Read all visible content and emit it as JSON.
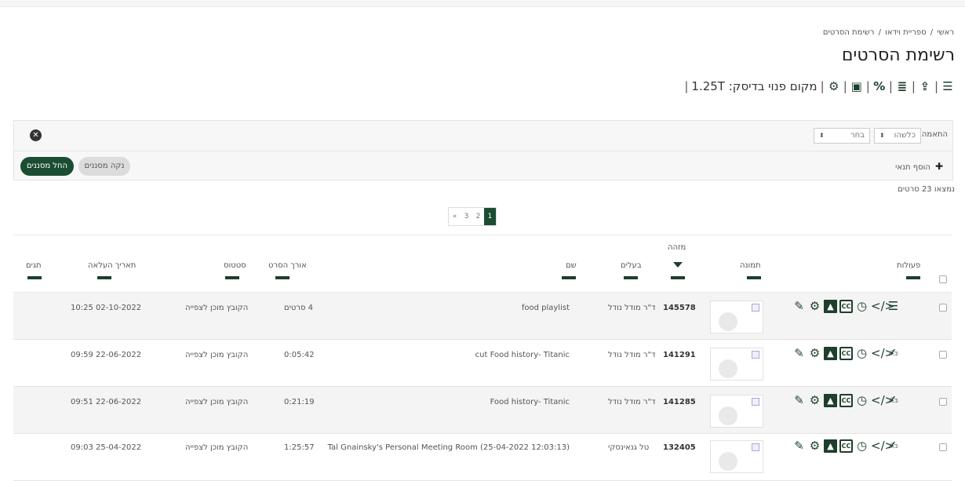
{
  "breadcrumb": [
    "ראשי",
    "ספריית וידאו",
    "רשימת הסרטים"
  ],
  "breadcrumb_sep": "/",
  "page_title": "רשימת הסרטים",
  "toolbar": {
    "disk_label": "מקום פנוי בדיסק:",
    "disk_value": "1.25T"
  },
  "filter": {
    "match_label": "התאמה",
    "select_any": "כלשהו",
    "select_choose": "בחר",
    "add_condition": "הוסף תנאי",
    "clear_button": "נקה מסננים",
    "apply_button": "החל מסננים"
  },
  "found_text": "נמצאו 23 סרטים",
  "pager": {
    "pages": [
      "«",
      "3",
      "2",
      "1"
    ],
    "active": "1"
  },
  "columns": {
    "actions": "פעולות",
    "image": "תמונה",
    "id_top": "מזהה",
    "owner": "בעלים",
    "name": "שם",
    "duration": "אורך הסרט",
    "status": "סטטוס",
    "upload_date": "תאריך העלאה",
    "tags": "תגים"
  },
  "rows": [
    {
      "id": "145578",
      "owner": "ד\"ר מודל נודל",
      "name": "food playlist",
      "duration": "4 סרטים",
      "status": "הקובץ מוכן לצפייה",
      "date": "02-10-2022 10:25",
      "type": "playlist"
    },
    {
      "id": "141291",
      "owner": "ד\"ר מודל נודל",
      "name": "cut Food history- Titanic",
      "duration": "0:05:42",
      "status": "הקובץ מוכן לצפייה",
      "date": "22-06-2022 09:59",
      "type": "video"
    },
    {
      "id": "141285",
      "owner": "ד\"ר מודל נודל",
      "name": "Food history- Titanic",
      "duration": "0:21:19",
      "status": "הקובץ מוכן לצפייה",
      "date": "22-06-2022 09:51",
      "type": "video"
    },
    {
      "id": "132405",
      "owner": "טל גנאינסקי",
      "name": "Tal Gnainsky's Personal Meeting Room (25-04-2022 12:03:13)",
      "duration": "1:25:57",
      "status": "הקובץ מוכן לצפייה",
      "date": "25-04-2022 09:03",
      "type": "video"
    }
  ],
  "colors": {
    "accent": "#1b4d32",
    "icon": "#1d3f2b"
  }
}
